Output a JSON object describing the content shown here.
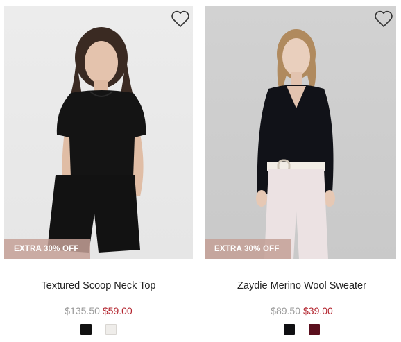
{
  "products": [
    {
      "name": "Textured Scoop Neck Top",
      "badge": "EXTRA 30% OFF",
      "price_was": "$135.50",
      "price_now": "$59.00",
      "swatches": [
        {
          "label": "black",
          "color": "#111111"
        },
        {
          "label": "ivory",
          "color": "#efedea"
        }
      ]
    },
    {
      "name": "Zaydie Merino Wool Sweater",
      "badge": "EXTRA 30% OFF",
      "price_was": "$89.50",
      "price_now": "$39.00",
      "swatches": [
        {
          "label": "black",
          "color": "#0f0f12"
        },
        {
          "label": "burgundy",
          "color": "#5a0f1d"
        }
      ]
    }
  ],
  "icons": {
    "wishlist": "heart-outline-icon"
  },
  "colors": {
    "sale_price": "#b3242e",
    "badge_bg": "#c4a096"
  }
}
